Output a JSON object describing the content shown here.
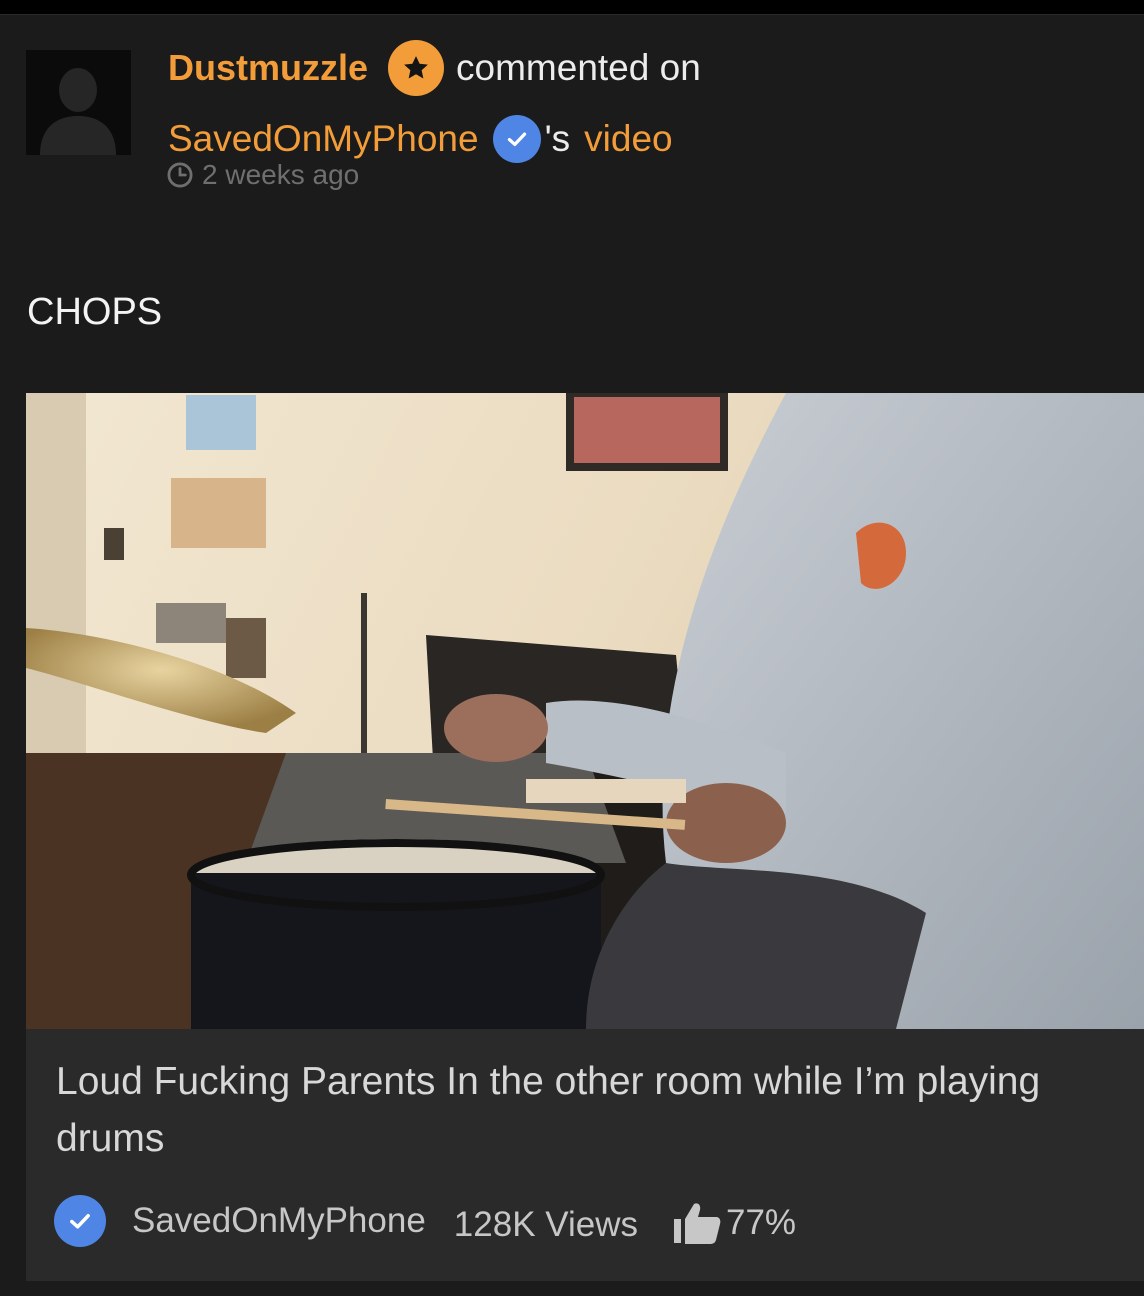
{
  "comment": {
    "username": "Dustmuzzle",
    "action_text": "commented on",
    "channel_name": "SavedOnMyPhone",
    "possessive": "'s",
    "video_link_text": "video",
    "timestamp": "2 weeks ago",
    "body": "CHOPS"
  },
  "video": {
    "title": "Loud Fucking Parents In the other room while I’m playing drums",
    "channel": "SavedOnMyPhone",
    "views": "128K Views",
    "rating": "77%"
  },
  "icons": {
    "avatar": "default-user-silhouette",
    "user_badge": "star-icon",
    "channel_badge": "verified-checkmark-icon",
    "time": "clock-icon",
    "rating": "thumbs-up-icon"
  },
  "colors": {
    "accent_orange": "#f29d39",
    "verified_blue": "#4f86e6",
    "background": "#1b1b1b",
    "video_card_bg": "#2a2a2a"
  }
}
